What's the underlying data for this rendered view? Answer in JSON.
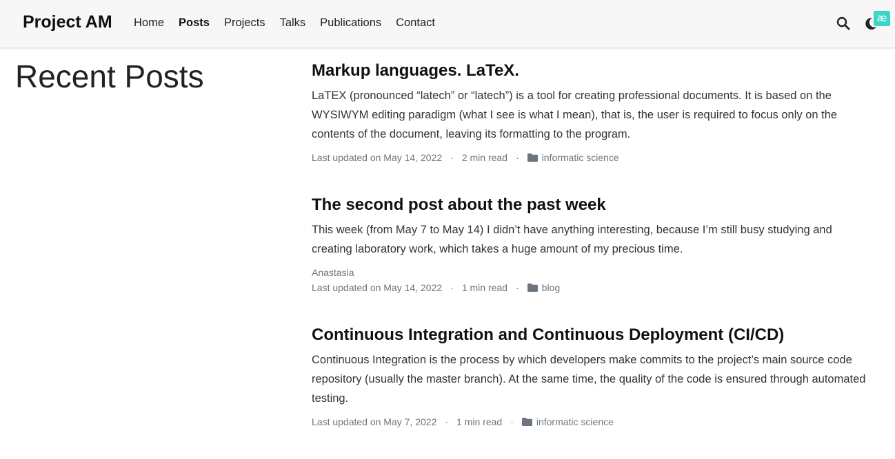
{
  "nav": {
    "brand": "Project AM",
    "links": [
      {
        "label": "Home"
      },
      {
        "label": "Posts"
      },
      {
        "label": "Projects"
      },
      {
        "label": "Talks"
      },
      {
        "label": "Publications"
      },
      {
        "label": "Contact"
      }
    ],
    "active": "Posts",
    "badge": "æ",
    "icons": [
      "search-icon",
      "moon-icon"
    ]
  },
  "page": {
    "heading": "Recent Posts"
  },
  "posts": [
    {
      "title": "Markup languages. LaTeX.",
      "summary": "LaTEX (pronounced “latech” or “latech”) is a tool for creating professional documents. It is based on the WYSIWYM editing paradigm (what I see is what I mean), that is, the user is required to focus only on the contents of the document, leaving its formatting to the program.",
      "updated": "Last updated on May 14, 2022",
      "read_time": "2 min read",
      "category": "informatic science"
    },
    {
      "title": "The second post about the past week",
      "summary": "This week (from May 7 to May 14) I didn’t have anything interesting, because I’m still busy studying and creating laboratory work, which takes a huge amount of my precious time.",
      "author": "Anastasia",
      "updated": "Last updated on May 14, 2022",
      "read_time": "1 min read",
      "category": "blog"
    },
    {
      "title": "Continuous Integration and Continuous Deployment (CI/CD)",
      "summary": "Continuous Integration is the process by which developers make commits to the project’s main source code repository (usually the master branch). At the same time, the quality of the code is ensured through automated testing.",
      "updated": "Last updated on May 7, 2022",
      "read_time": "1 min read",
      "category": "informatic science"
    }
  ],
  "meta_separator": "·",
  "colors": {
    "navbar_bg": "#f7f7f7",
    "badge": "#3dd6c6",
    "meta_text": "#6c757d"
  }
}
